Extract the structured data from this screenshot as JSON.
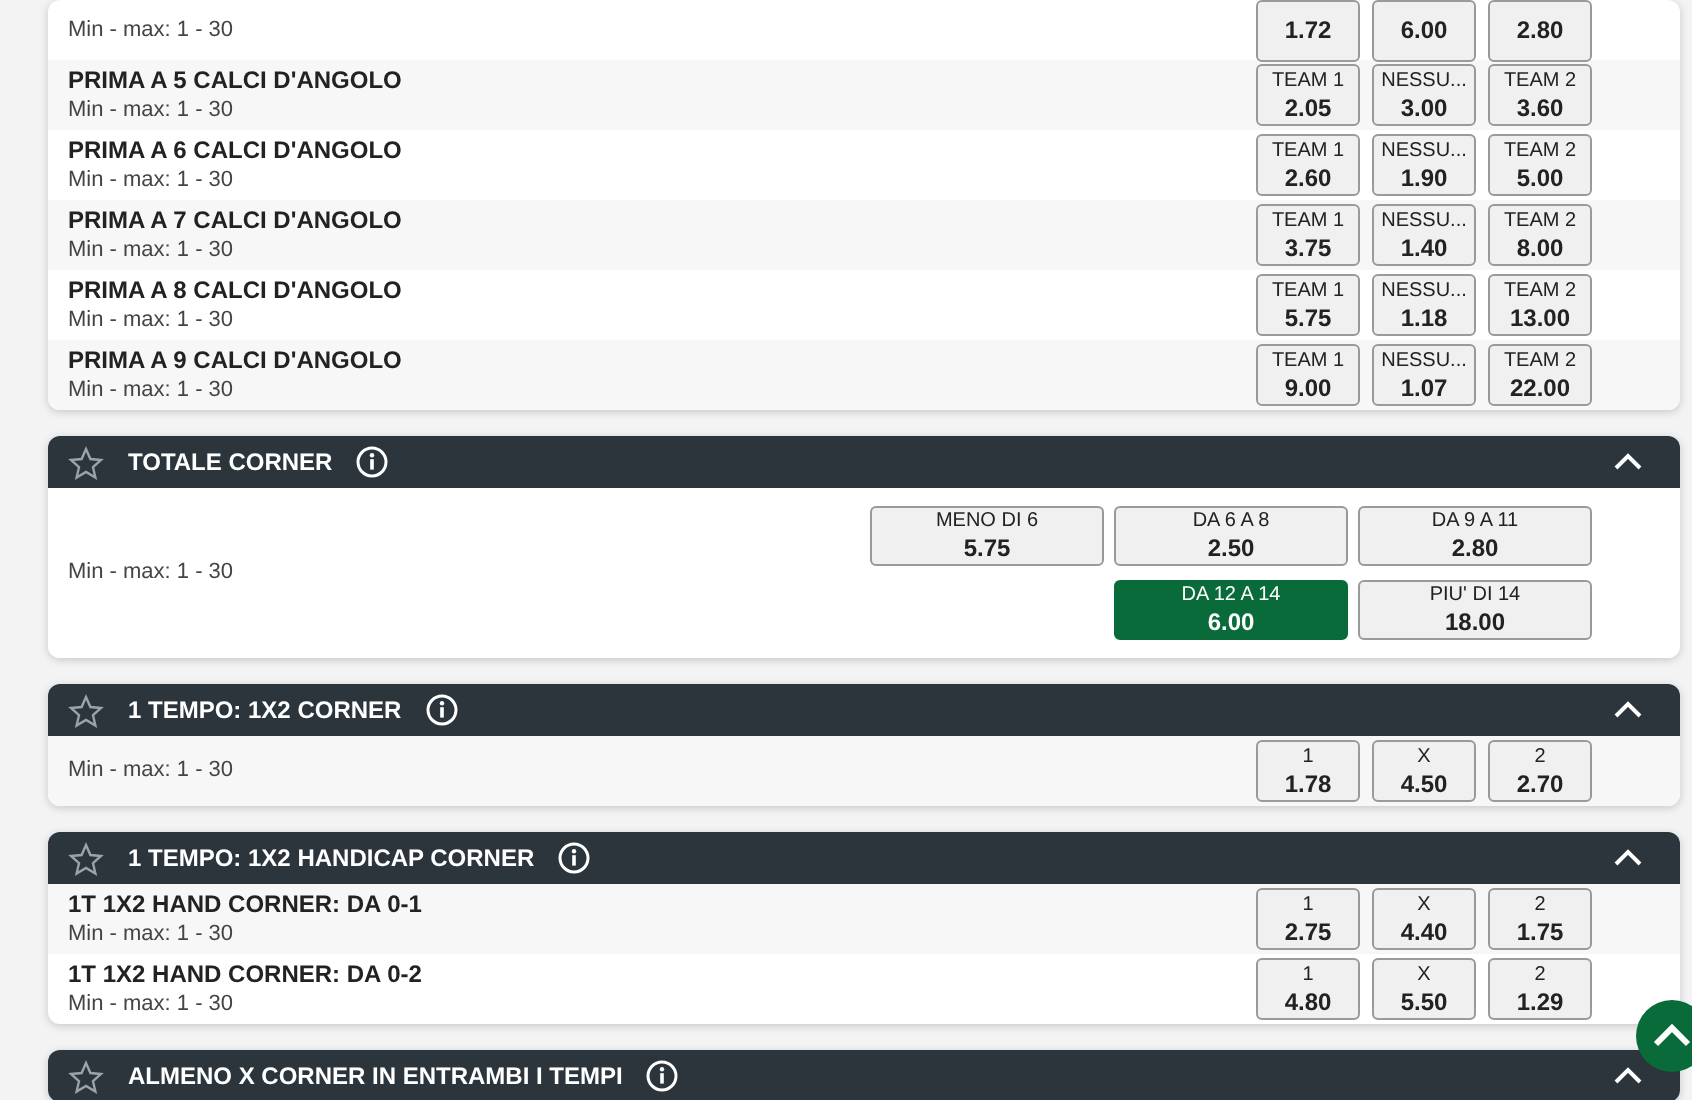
{
  "sections": [
    {
      "kind": "list",
      "rows": [
        {
          "limits": "Min - max: 1 - 30",
          "outcomes": [
            {
              "odds": "1.72",
              "selected": false
            },
            {
              "odds": "6.00",
              "selected": false
            },
            {
              "odds": "2.80",
              "selected": false
            }
          ]
        },
        {
          "name": "PRIMA A 5 CALCI D'ANGOLO",
          "limits": "Min - max: 1 - 30",
          "outcomes": [
            {
              "label": "TEAM 1",
              "odds": "2.05",
              "selected": false
            },
            {
              "label": "NESSU...",
              "odds": "3.00",
              "selected": false
            },
            {
              "label": "TEAM 2",
              "odds": "3.60",
              "selected": false
            }
          ]
        },
        {
          "name": "PRIMA A 6 CALCI D'ANGOLO",
          "limits": "Min - max: 1 - 30",
          "outcomes": [
            {
              "label": "TEAM 1",
              "odds": "2.60",
              "selected": false
            },
            {
              "label": "NESSU...",
              "odds": "1.90",
              "selected": false
            },
            {
              "label": "TEAM 2",
              "odds": "5.00",
              "selected": false
            }
          ]
        },
        {
          "name": "PRIMA A 7 CALCI D'ANGOLO",
          "limits": "Min - max: 1 - 30",
          "outcomes": [
            {
              "label": "TEAM 1",
              "odds": "3.75",
              "selected": false
            },
            {
              "label": "NESSU...",
              "odds": "1.40",
              "selected": false
            },
            {
              "label": "TEAM 2",
              "odds": "8.00",
              "selected": false
            }
          ]
        },
        {
          "name": "PRIMA A 8 CALCI D'ANGOLO",
          "limits": "Min - max: 1 - 30",
          "outcomes": [
            {
              "label": "TEAM 1",
              "odds": "5.75",
              "selected": false
            },
            {
              "label": "NESSU...",
              "odds": "1.18",
              "selected": false
            },
            {
              "label": "TEAM 2",
              "odds": "13.00",
              "selected": false
            }
          ]
        },
        {
          "name": "PRIMA A 9 CALCI D'ANGOLO",
          "limits": "Min - max: 1 - 30",
          "outcomes": [
            {
              "label": "TEAM 1",
              "odds": "9.00",
              "selected": false
            },
            {
              "label": "NESSU...",
              "odds": "1.07",
              "selected": false
            },
            {
              "label": "TEAM 2",
              "odds": "22.00",
              "selected": false
            }
          ]
        }
      ]
    },
    {
      "title": "TOTALE CORNER",
      "kind": "grid",
      "expanded": true,
      "rows": [
        {
          "limits": "Min - max: 1 - 30",
          "outcome_rows": [
            [
              {
                "label": "MENO DI 6",
                "odds": "5.75",
                "selected": false
              },
              {
                "label": "DA 6 A 8",
                "odds": "2.50",
                "selected": false
              },
              {
                "label": "DA 9 A 11",
                "odds": "2.80",
                "selected": false
              }
            ],
            [
              {
                "label": "DA 12 A 14",
                "odds": "6.00",
                "selected": true
              },
              {
                "label": "PIU' DI 14",
                "odds": "18.00",
                "selected": false
              }
            ]
          ]
        }
      ]
    },
    {
      "title": "1 TEMPO: 1X2 CORNER",
      "kind": "list",
      "expanded": true,
      "rows": [
        {
          "limits": "Min - max: 1 - 30",
          "outcomes": [
            {
              "label": "1",
              "odds": "1.78",
              "selected": false
            },
            {
              "label": "X",
              "odds": "4.50",
              "selected": false
            },
            {
              "label": "2",
              "odds": "2.70",
              "selected": false
            }
          ]
        }
      ]
    },
    {
      "title": "1 TEMPO: 1X2 HANDICAP CORNER",
      "kind": "list",
      "expanded": true,
      "rows": [
        {
          "name": "1T 1X2 HAND CORNER: DA 0-1",
          "limits": "Min - max: 1 - 30",
          "outcomes": [
            {
              "label": "1",
              "odds": "2.75",
              "selected": false
            },
            {
              "label": "X",
              "odds": "4.40",
              "selected": false
            },
            {
              "label": "2",
              "odds": "1.75",
              "selected": false
            }
          ]
        },
        {
          "name": "1T 1X2 HAND CORNER: DA 0-2",
          "limits": "Min - max: 1 - 30",
          "outcomes": [
            {
              "label": "1",
              "odds": "4.80",
              "selected": false
            },
            {
              "label": "X",
              "odds": "5.50",
              "selected": false
            },
            {
              "label": "2",
              "odds": "1.29",
              "selected": false
            }
          ]
        }
      ]
    },
    {
      "title": "ALMENO X CORNER IN ENTRAMBI I TEMPI",
      "expanded": true
    }
  ]
}
